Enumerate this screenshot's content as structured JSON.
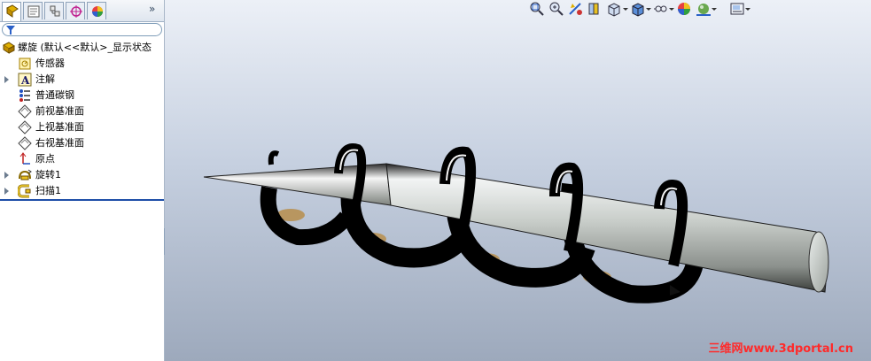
{
  "panel": {
    "tabs": [
      {
        "icon": "feature-manager-icon"
      },
      {
        "icon": "property-manager-icon"
      },
      {
        "icon": "configuration-manager-icon"
      },
      {
        "icon": "dimxpert-icon"
      },
      {
        "icon": "display-manager-icon"
      }
    ],
    "more_label": "»",
    "filter_icon": "filter-icon",
    "tree": {
      "root_label": "螺旋 (默认<<默认>_显示状态",
      "items": [
        {
          "label": "传感器",
          "icon": "sensor-icon",
          "expandable": false
        },
        {
          "label": "注解",
          "icon": "annotation-icon",
          "expandable": true
        },
        {
          "label": "普通碳钢",
          "icon": "material-icon",
          "expandable": false
        },
        {
          "label": "前视基准面",
          "icon": "plane-icon",
          "expandable": false
        },
        {
          "label": "上视基准面",
          "icon": "plane-icon",
          "expandable": false
        },
        {
          "label": "右视基准面",
          "icon": "plane-icon",
          "expandable": false
        },
        {
          "label": "原点",
          "icon": "origin-icon",
          "expandable": false
        },
        {
          "label": "旋转1",
          "icon": "revolve-icon",
          "expandable": true
        },
        {
          "label": "扫描1",
          "icon": "sweep-icon",
          "expandable": true
        }
      ]
    }
  },
  "viewport": {
    "toolbar": [
      {
        "icon": "zoom-to-fit-icon"
      },
      {
        "icon": "zoom-to-area-icon"
      },
      {
        "icon": "previous-view-icon"
      },
      {
        "icon": "section-view-icon"
      },
      {
        "icon": "view-orientation-icon"
      },
      {
        "icon": "display-style-icon"
      },
      {
        "icon": "hide-show-items-icon"
      },
      {
        "icon": "edit-appearance-icon"
      },
      {
        "icon": "apply-scene-icon"
      },
      {
        "icon": "view-settings-icon"
      }
    ],
    "background_top": "#ecf0f7",
    "background_bottom": "#9da9bc",
    "watermark": "三维网www.3dportal.cn"
  }
}
